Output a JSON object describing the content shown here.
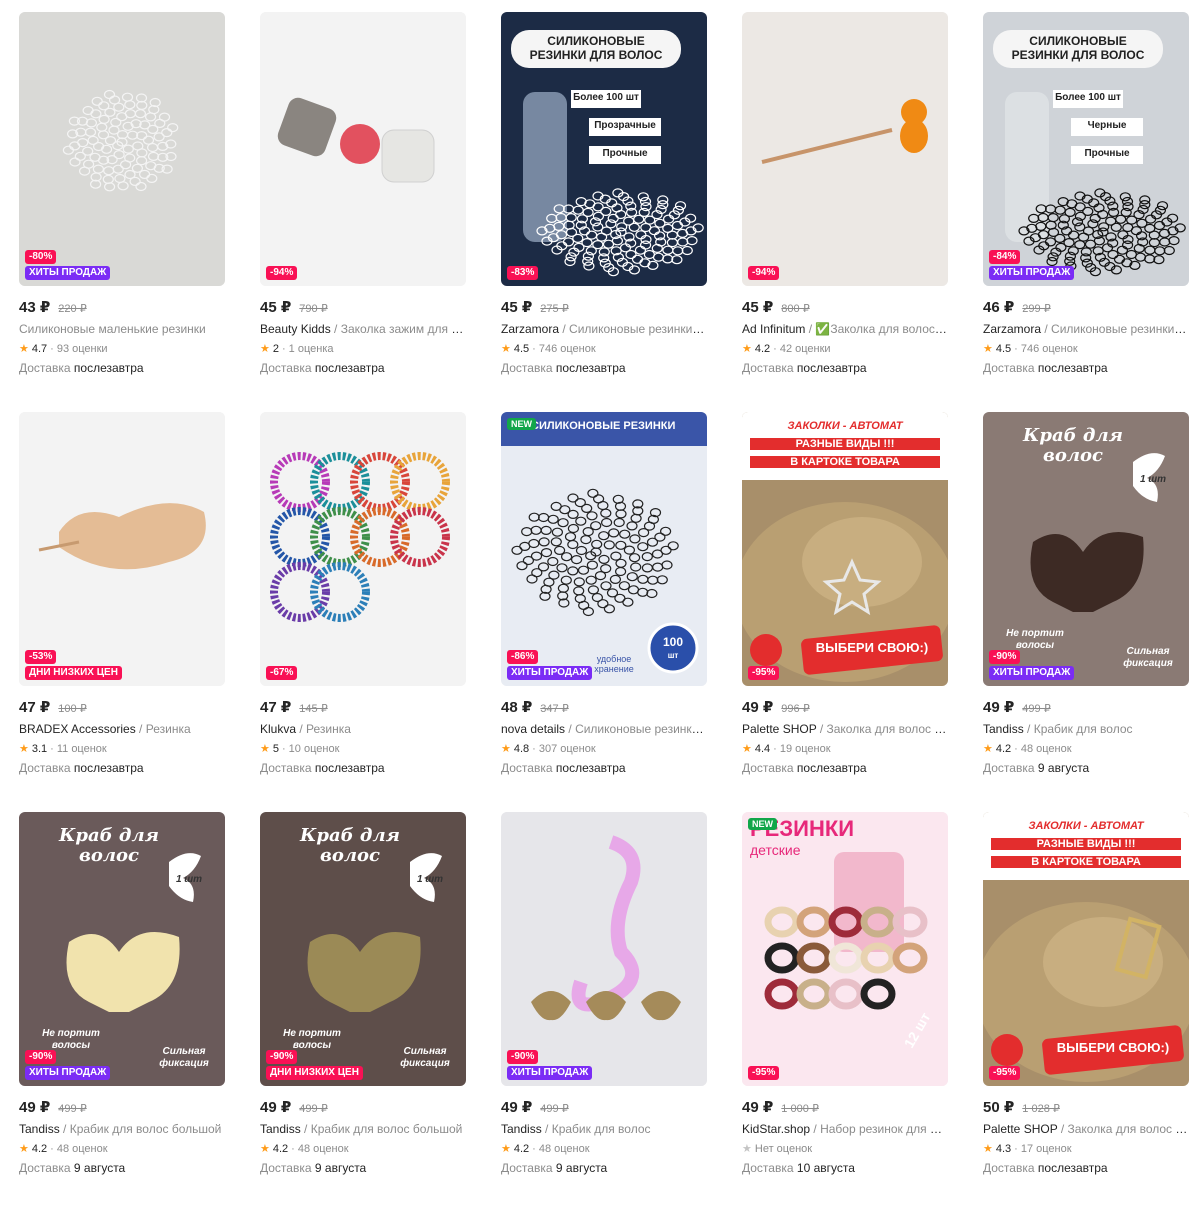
{
  "currency": "₽",
  "products": [
    {
      "price": "43 ₽",
      "old": "220 ₽",
      "discount": "-80%",
      "badge": "ХИТЫ ПРОДАЖ",
      "badge_type": "hit",
      "brand": "",
      "desc": "Силиконовые маленькие резинки",
      "rating": "4.7",
      "reviews": "93 оценки",
      "delivery_label": "Доставка",
      "delivery_when": "послезавтра",
      "image": "clear-bands"
    },
    {
      "price": "45 ₽",
      "old": "790 ₽",
      "discount": "-94%",
      "badge": "",
      "badge_type": "",
      "brand": "Beauty Kidds",
      "desc": "Заколка зажим для волос",
      "rating": "2",
      "reviews": "1 оценка",
      "delivery_label": "Доставка",
      "delivery_when": "послезавтра",
      "image": "clip-pink"
    },
    {
      "price": "45 ₽",
      "old": "275 ₽",
      "discount": "-83%",
      "badge": "",
      "badge_type": "",
      "brand": "Zarzamora",
      "desc": "Силиконовые резинки для волос",
      "rating": "4.5",
      "reviews": "746 оценок",
      "delivery_label": "Доставка",
      "delivery_when": "послезавтра",
      "image": "silicone-clear",
      "overlay": [
        "СИЛИКОНОВЫЕ",
        "РЕЗИНКИ ДЛЯ ВОЛОС",
        "Более 100 шт",
        "Прозрачные",
        "Прочные"
      ]
    },
    {
      "price": "45 ₽",
      "old": "800 ₽",
      "discount": "-94%",
      "badge": "",
      "badge_type": "",
      "brand": "Ad Infinitum",
      "desc": "✅Заколка для волос невидимка",
      "rating": "4.2",
      "reviews": "42 оценки",
      "delivery_label": "Доставка",
      "delivery_when": "послезавтра",
      "image": "bear-pin"
    },
    {
      "price": "46 ₽",
      "old": "299 ₽",
      "discount": "-84%",
      "badge": "ХИТЫ ПРОДАЖ",
      "badge_type": "hit",
      "brand": "Zarzamora",
      "desc": "Силиконовые резинки для волос",
      "rating": "4.5",
      "reviews": "746 оценок",
      "delivery_label": "Доставка",
      "delivery_when": "послезавтра",
      "image": "silicone-black",
      "overlay": [
        "СИЛИКОНОВЫЕ",
        "РЕЗИНКИ ДЛЯ ВОЛОС",
        "Более 100 шт",
        "Черные",
        "Прочные"
      ]
    },
    {
      "price": "47 ₽",
      "old": "100 ₽",
      "discount": "-53%",
      "badge": "ДНИ НИЗКИХ ЦЕН",
      "badge_type": "low",
      "brand": "BRADEX Accessories",
      "desc": "Резинка",
      "rating": "3.1",
      "reviews": "11 оценок",
      "delivery_label": "Доставка",
      "delivery_when": "послезавтра",
      "image": "heart-clip"
    },
    {
      "price": "47 ₽",
      "old": "145 ₽",
      "discount": "-67%",
      "badge": "",
      "badge_type": "",
      "brand": "Klukva",
      "desc": "Резинка",
      "rating": "5",
      "reviews": "10 оценок",
      "delivery_label": "Доставка",
      "delivery_when": "послезавтра",
      "image": "spiral"
    },
    {
      "price": "48 ₽",
      "old": "347 ₽",
      "discount": "-86%",
      "badge": "ХИТЫ ПРОДАЖ",
      "badge_type": "hit",
      "brand": "nova details",
      "desc": "Силиконовые резинки для волос",
      "rating": "4.8",
      "reviews": "307 оценок",
      "delivery_label": "Доставка",
      "delivery_when": "послезавтра",
      "image": "nova",
      "new": "NEW",
      "overlay": [
        "СИЛИКОНОВЫЕ РЕЗИНКИ",
        "100",
        "шт",
        "удобное хранение"
      ]
    },
    {
      "price": "49 ₽",
      "old": "996 ₽",
      "discount": "-95%",
      "badge": "",
      "badge_type": "",
      "brand": "Palette SHOP",
      "desc": "Заколка для волос звезда",
      "rating": "4.4",
      "reviews": "19 оценок",
      "delivery_label": "Доставка",
      "delivery_when": "послезавтра",
      "image": "auto-star",
      "overlay": [
        "ЗАКОЛКИ - АВТОМАТ",
        "РАЗНЫЕ ВИДЫ !!!",
        "В КАРТОКЕ ТОВАРА",
        "ВЫБЕРИ СВОЮ:)"
      ]
    },
    {
      "price": "49 ₽",
      "old": "499 ₽",
      "discount": "-90%",
      "badge": "ХИТЫ ПРОДАЖ",
      "badge_type": "hit",
      "brand": "Tandiss",
      "desc": "Крабик для волос",
      "rating": "4.2",
      "reviews": "48 оценок",
      "delivery_label": "Доставка",
      "delivery_when": "9 августа",
      "image": "crab-brown",
      "overlay": [
        "Краб для",
        "волос",
        "1 шт",
        "Не портит",
        "волосы",
        "Сильная",
        "фиксация"
      ]
    },
    {
      "price": "49 ₽",
      "old": "499 ₽",
      "discount": "-90%",
      "badge": "ХИТЫ ПРОДАЖ",
      "badge_type": "hit",
      "brand": "Tandiss",
      "desc": "Крабик для волос большой",
      "rating": "4.2",
      "reviews": "48 оценок",
      "delivery_label": "Доставка",
      "delivery_when": "9 августа",
      "image": "crab-cream",
      "overlay": [
        "Краб для",
        "волос",
        "1 шт",
        "Не портит",
        "волосы",
        "Сильная",
        "фиксация"
      ]
    },
    {
      "price": "49 ₽",
      "old": "499 ₽",
      "discount": "-90%",
      "badge": "ДНИ НИЗКИХ ЦЕН",
      "badge_type": "low",
      "brand": "Tandiss",
      "desc": "Крабик для волос большой",
      "rating": "4.2",
      "reviews": "48 оценок",
      "delivery_label": "Доставка",
      "delivery_when": "9 августа",
      "image": "crab-khaki",
      "overlay": [
        "Краб для",
        "волос",
        "1 шт",
        "Не портит",
        "волосы",
        "Сильная",
        "фиксация"
      ]
    },
    {
      "price": "49 ₽",
      "old": "499 ₽",
      "discount": "-90%",
      "badge": "ХИТЫ ПРОДАЖ",
      "badge_type": "hit",
      "brand": "Tandiss",
      "desc": "Крабик для волос",
      "rating": "4.2",
      "reviews": "48 оценок",
      "delivery_label": "Доставка",
      "delivery_when": "9 августа",
      "image": "flamingo"
    },
    {
      "price": "49 ₽",
      "old": "1 000 ₽",
      "discount": "-95%",
      "badge": "",
      "badge_type": "",
      "brand": "KidStar.shop",
      "desc": "Набор резинок для волос",
      "rating": "",
      "reviews": "Нет оценок",
      "delivery_label": "Доставка",
      "delivery_when": "10 августа",
      "image": "kids",
      "new": "NEW",
      "overlay": [
        "РЕЗИНКИ",
        "детские",
        "12 шт"
      ]
    },
    {
      "price": "50 ₽",
      "old": "1 028 ₽",
      "discount": "-95%",
      "badge": "",
      "badge_type": "",
      "brand": "Palette SHOP",
      "desc": "Заколка для волос золотая",
      "rating": "4.3",
      "reviews": "17 оценок",
      "delivery_label": "Доставка",
      "delivery_when": "послезавтра",
      "image": "auto-rect",
      "overlay": [
        "ЗАКОЛКИ - АВТОМАТ",
        "РАЗНЫЕ ВИДЫ !!!",
        "В КАРТОКЕ ТОВАРА",
        "ВЫБЕРИ СВОЮ:)"
      ]
    }
  ]
}
